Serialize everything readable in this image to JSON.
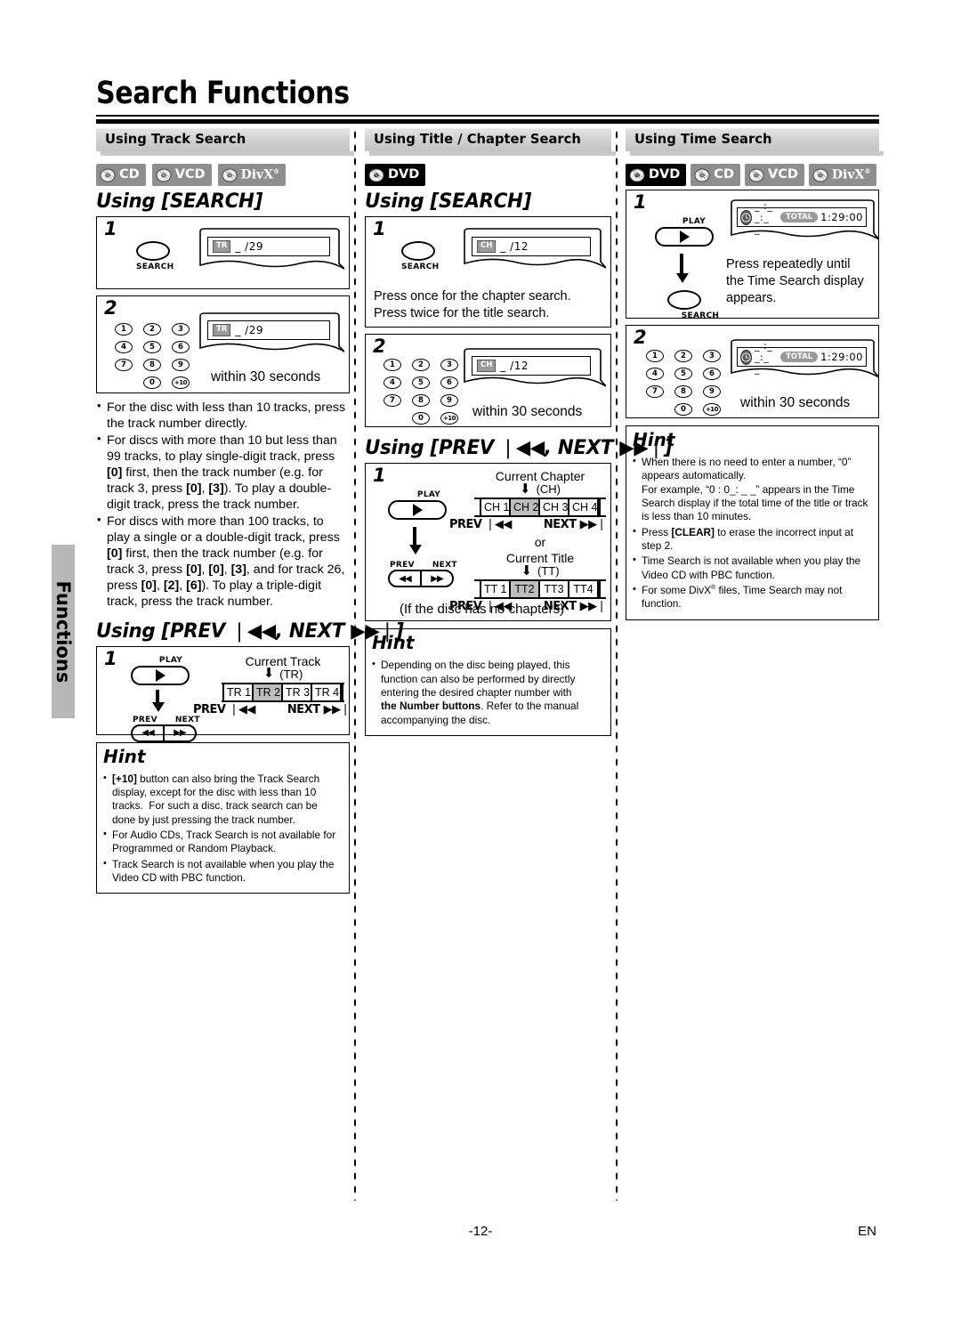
{
  "page": {
    "title": "Search Functions",
    "side_tab": "Functions",
    "footer_page": "-12-",
    "footer_lang": "EN"
  },
  "sections": {
    "track": {
      "heading": "Using Track Search",
      "discs": [
        {
          "label": "CD",
          "style": "gray"
        },
        {
          "label": "VCD",
          "style": "gray"
        },
        {
          "label": "DivX",
          "style": "gray",
          "sup": "®"
        }
      ],
      "using_search": "Using [SEARCH]",
      "using_prevnext": "Using [PREV ❘◀◀, NEXT ▶▶❘]",
      "step1": {
        "num": "1",
        "button": "SEARCH",
        "vfd_tag": "TR",
        "vfd_value": "_ /29"
      },
      "step2": {
        "num": "2",
        "vfd_tag": "TR",
        "vfd_value": "_ /29",
        "note": "within 30 seconds"
      },
      "bullets": [
        "For the disc with less than 10 tracks, press the track number directly.",
        "For discs with more than 10 but less than 99 tracks, to play single-digit track, press [0] first, then the track number (e.g. for track 3, press [0], [3]). To play a double-digit track, press the track number.",
        "For discs with more than 100 tracks, to play a single or a double-digit track, press [0] first, then the track number (e.g. for track 3, press [0], [0], [3], and for track 26, press [0], [2], [6]). To play a triple-digit track, press the track number."
      ],
      "prevnext_step": {
        "num": "1",
        "play_label": "PLAY",
        "prev_label": "PREV",
        "next_label": "NEXT",
        "current_label": "Current Track",
        "current_abbr": "(TR)",
        "segments": [
          "TR 1",
          "TR 2",
          "TR 3",
          "TR 4"
        ],
        "highlight_index": 1,
        "prev_btn": "PREV ❘◀◀",
        "next_btn": "NEXT ▶▶❘"
      },
      "hint": {
        "title": "Hint",
        "items": [
          "[+10] button can also bring the Track Search display, except for the disc with less than 10 tracks.  For such a disc, track search can be done by just pressing the track number.",
          "For Audio CDs, Track Search is not available for Programmed or Random Playback.",
          "Track Search is not available when you play the Video CD with PBC function."
        ]
      }
    },
    "title_chapter": {
      "heading": "Using Title / Chapter Search",
      "discs": [
        {
          "label": "DVD",
          "style": "black"
        }
      ],
      "using_search": "Using [SEARCH]",
      "using_prevnext": "Using [PREV ❘◀◀, NEXT ▶▶❘]",
      "step1": {
        "num": "1",
        "button": "SEARCH",
        "vfd_tag": "CH",
        "vfd_value": "_ /12"
      },
      "step1_note_line1": "Press once for the chapter search.",
      "step1_note_line2": "Press twice for the title search.",
      "step2": {
        "num": "2",
        "vfd_tag": "CH",
        "vfd_value": "_ /12",
        "note": "within 30 seconds"
      },
      "prevnext_step": {
        "num": "1",
        "play_label": "PLAY",
        "prev_label": "PREV",
        "next_label": "NEXT",
        "chapter_label": "Current Chapter",
        "chapter_abbr": "(CH)",
        "chapter_segments": [
          "CH 1",
          "CH 2",
          "CH 3",
          "CH 4"
        ],
        "chapter_highlight_index": 1,
        "or_label": "or",
        "title_label": "Current Title",
        "title_abbr": "(TT)",
        "title_segments": [
          "TT 1",
          "TT2",
          "TT3",
          "TT4"
        ],
        "title_highlight_index": 1,
        "prev_btn": "PREV ❘◀◀",
        "next_btn": "NEXT ▶▶❘",
        "footnote": "(If the disc has no chapters)"
      },
      "hint": {
        "title": "Hint",
        "items": [
          "Depending on the disc being played, this function can also be performed by directly entering the desired chapter number with the Number buttons. Refer to the manual accompanying the disc."
        ]
      }
    },
    "time": {
      "heading": "Using Time Search",
      "discs": [
        {
          "label": "DVD",
          "style": "black"
        },
        {
          "label": "CD",
          "style": "gray"
        },
        {
          "label": "VCD",
          "style": "gray"
        },
        {
          "label": "DivX",
          "style": "gray",
          "sup": "®"
        }
      ],
      "step1": {
        "num": "1",
        "play_label": "PLAY",
        "search_label": "SEARCH",
        "vfd_value": "_ :_ _:_ _",
        "vfd_pill": "TOTAL",
        "vfd_time": "1:29:00",
        "note_line1": "Press repeatedly until",
        "note_line2": "the Time Search display",
        "note_line3": "appears."
      },
      "step2": {
        "num": "2",
        "vfd_value": "_ :_ _:_ _",
        "vfd_pill": "TOTAL",
        "vfd_time": "1:29:00",
        "note": "within 30 seconds"
      },
      "hint": {
        "title": "Hint",
        "items": [
          "When there is no need to enter a number, “0” appears automatically. For example, “0 : 0_: _ _” appears in the Time Search display if the total time of the title or track is less than 10 minutes.",
          "Press [CLEAR] to erase the incorrect input at step 2.",
          "Time Search is not available when you play the Video CD with PBC function.",
          "For some DivX® files, Time Search may not function."
        ]
      }
    }
  },
  "keypad": {
    "rows": [
      [
        "1",
        "2",
        "3"
      ],
      [
        "4",
        "5",
        "6"
      ],
      [
        "7",
        "8",
        "9"
      ]
    ],
    "last_row": [
      "0",
      "+10"
    ]
  }
}
